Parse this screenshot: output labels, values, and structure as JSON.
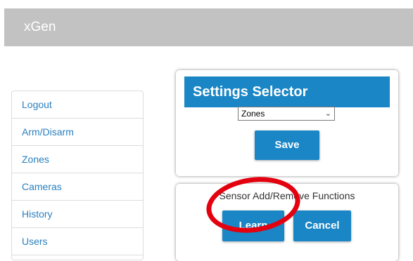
{
  "header": {
    "brand": "xGen"
  },
  "sidebar": {
    "items": [
      {
        "label": "Logout"
      },
      {
        "label": "Arm/Disarm"
      },
      {
        "label": "Zones"
      },
      {
        "label": "Cameras"
      },
      {
        "label": "History"
      },
      {
        "label": "Users"
      }
    ]
  },
  "settings": {
    "title": "Settings Selector",
    "selected_option": "Zones",
    "save_label": "Save"
  },
  "sensor": {
    "subtitle": "Sensor Add/Remove Functions",
    "learn_label": "Learn",
    "cancel_label": "Cancel"
  },
  "colors": {
    "header_bg": "#c2c2c2",
    "accent": "#1a86c6",
    "nav_link": "#2a7fbf",
    "annotation": "#e3000f"
  }
}
